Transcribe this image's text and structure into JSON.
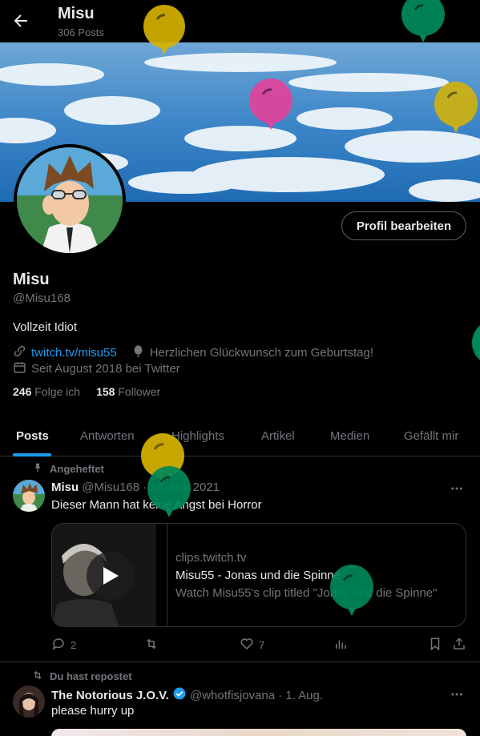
{
  "header": {
    "title": "Misu",
    "post_count": "306 Posts"
  },
  "profile": {
    "edit_button": "Profil bearbeiten",
    "name": "Misu",
    "handle": "@Misu168",
    "bio": "Vollzeit Idiot",
    "website": "twitch.tv/misu55",
    "birthday_note": "Herzlichen Glückwunsch zum Geburtstag!",
    "joined": "Seit August 2018 bei Twitter",
    "following_count": "246",
    "following_label": "Folge ich",
    "followers_count": "158",
    "followers_label": "Follower"
  },
  "tabs": [
    {
      "label": "Posts"
    },
    {
      "label": "Antworten"
    },
    {
      "label": "Highlights"
    },
    {
      "label": "Artikel"
    },
    {
      "label": "Medien"
    },
    {
      "label": "Gefällt mir"
    }
  ],
  "posts": [
    {
      "context": "Angeheftet",
      "author": "Misu",
      "handle": "@Misu168",
      "date": "· 14. Mai 2021",
      "text": "Dieser Mann hat keine Angst bei Horror",
      "card": {
        "domain": "clips.twitch.tv",
        "title": "Misu55 - Jonas und die Spinne",
        "description": "Watch Misu55's clip titled \"Jonas und die Spinne\""
      },
      "replies": "2",
      "reposts": "",
      "likes": "7"
    },
    {
      "context": "Du hast repostet",
      "author": "The Notorious J.O.V.",
      "handle": "@whotfisjovana",
      "date": "· 1. Aug.",
      "text": "please hurry up"
    }
  ],
  "colors": {
    "accent": "#1d9bf0",
    "background": "#000000",
    "muted": "#71767b",
    "balloon_yellow": "#d9b400",
    "balloon_green": "#00875a",
    "balloon_pink": "#e0439a"
  },
  "icons": [
    "back-arrow-icon",
    "link-icon",
    "balloon-icon",
    "calendar-icon",
    "pin-icon",
    "more-icon",
    "play-icon",
    "reply-icon",
    "repost-icon",
    "like-icon",
    "views-icon",
    "bookmark-icon",
    "share-icon",
    "verified-icon"
  ]
}
